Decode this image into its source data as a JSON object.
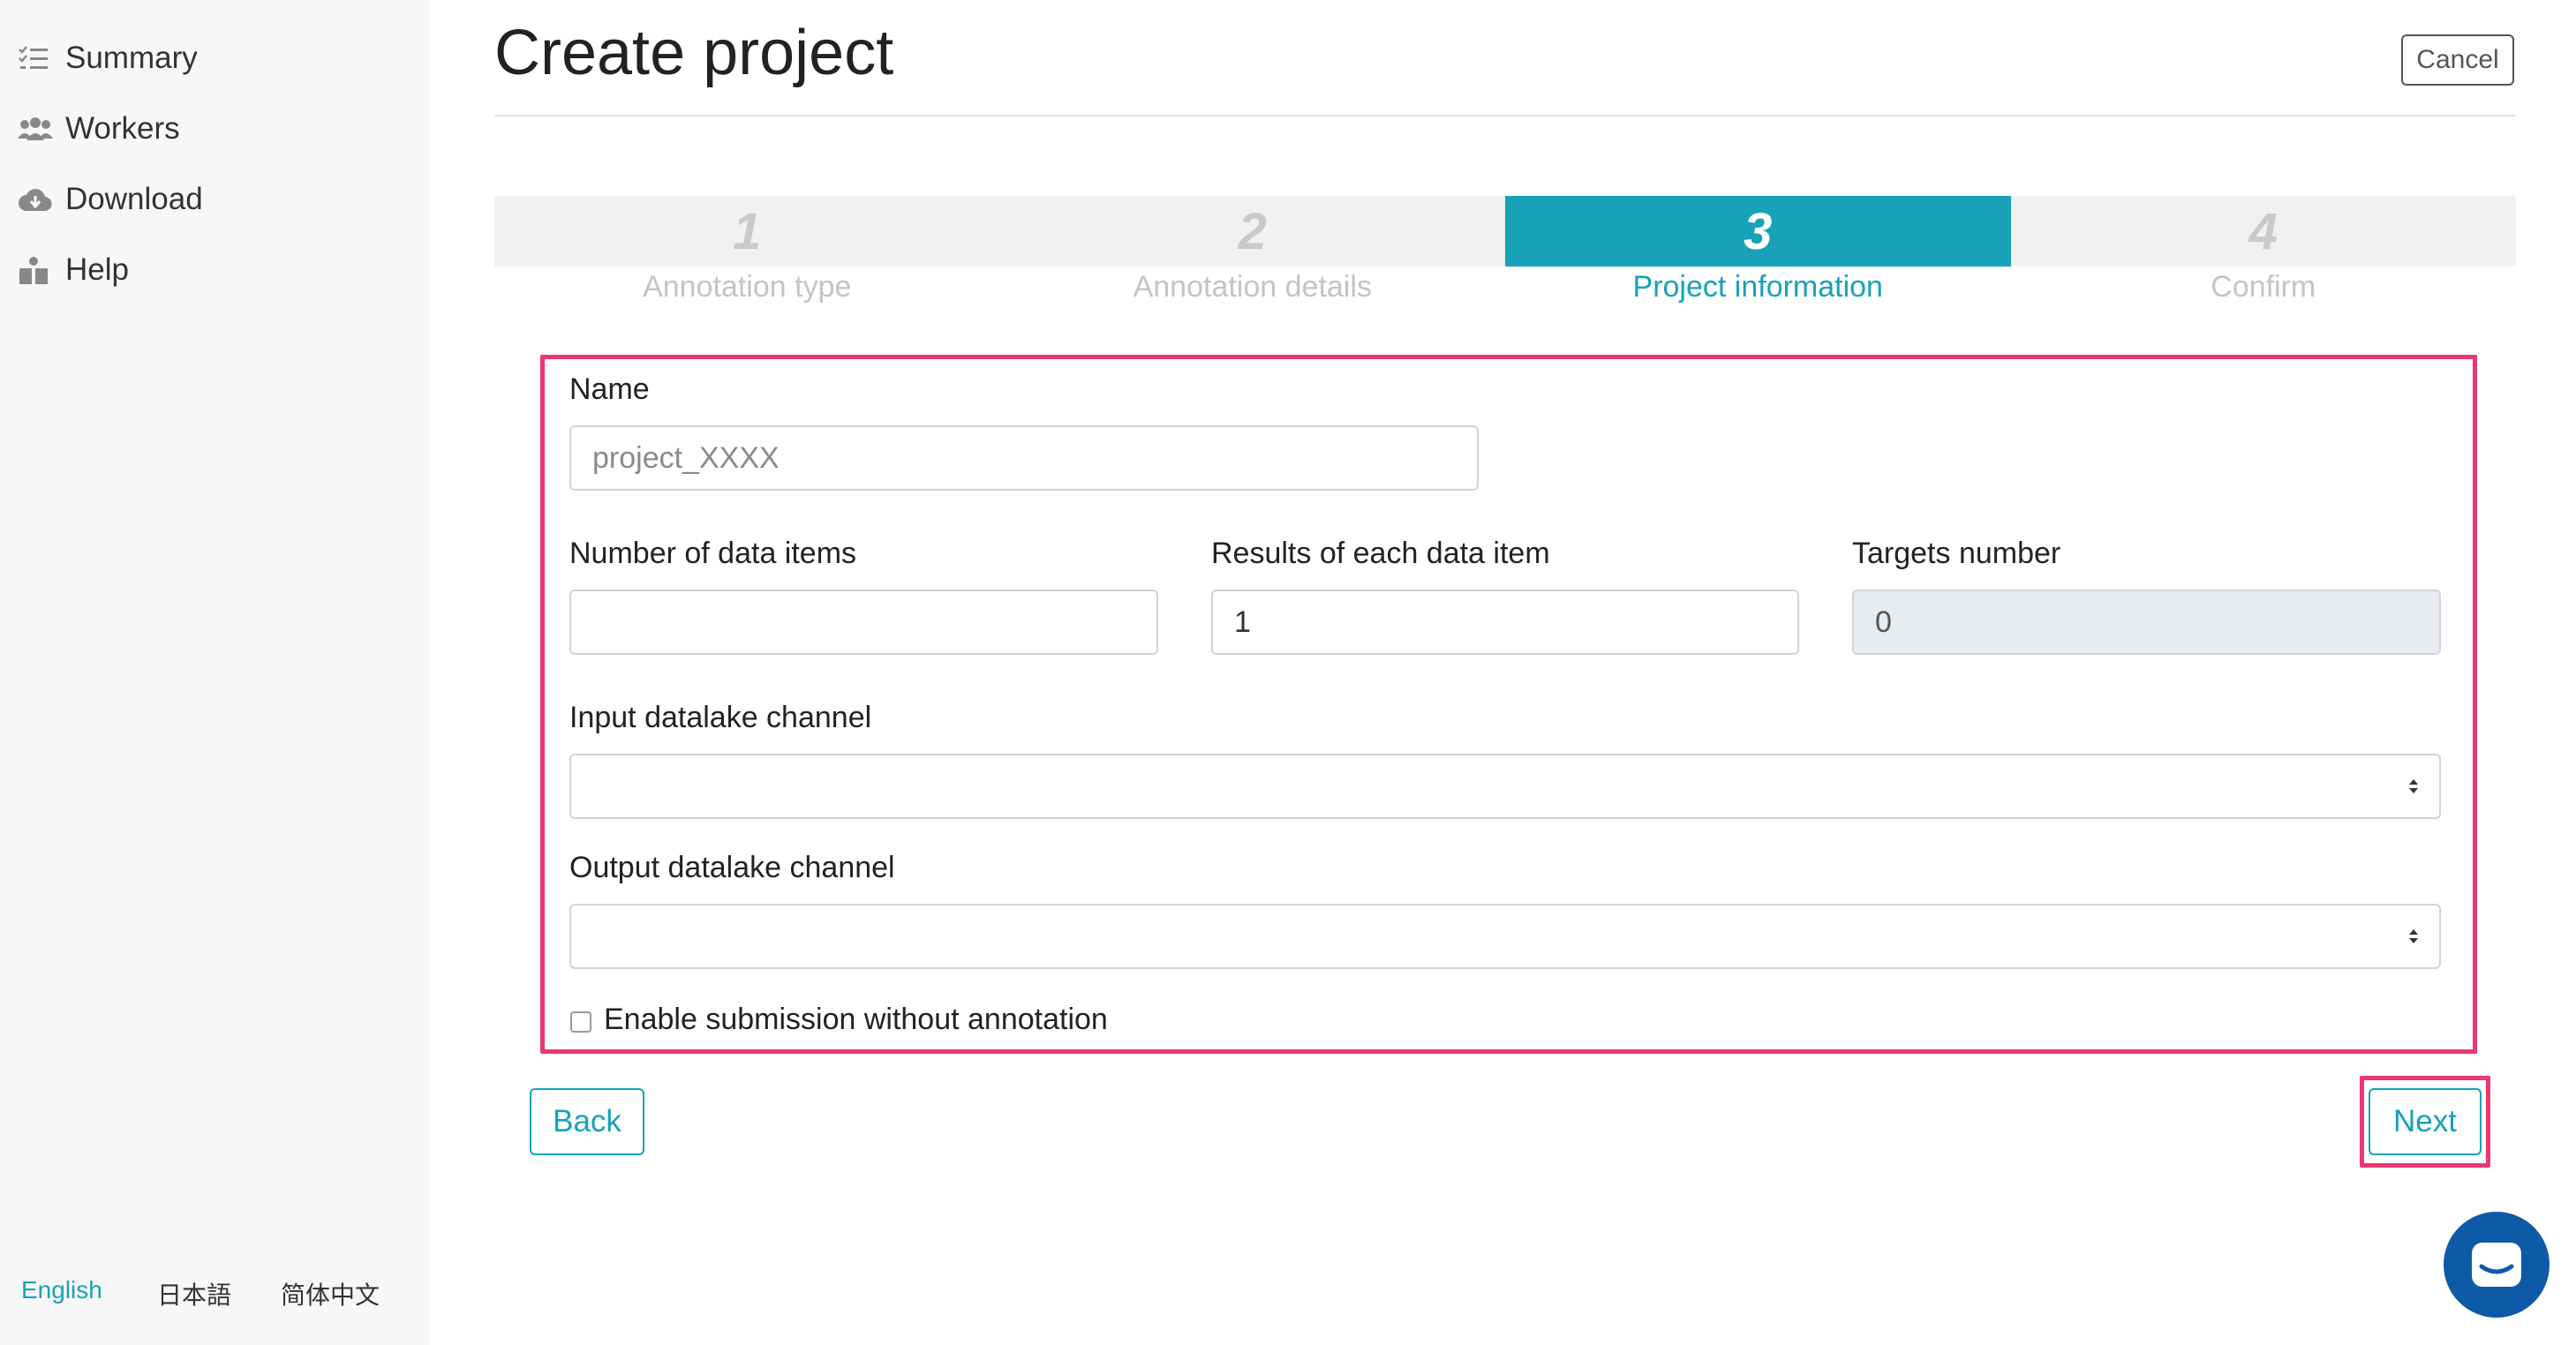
{
  "sidebar": {
    "items": [
      {
        "label": "Summary",
        "icon": "list-check-icon"
      },
      {
        "label": "Workers",
        "icon": "users-icon"
      },
      {
        "label": "Download",
        "icon": "cloud-download-icon"
      },
      {
        "label": "Help",
        "icon": "help-person-icon"
      }
    ],
    "languages": [
      {
        "label": "English",
        "active": true
      },
      {
        "label": "日本語",
        "active": false
      },
      {
        "label": "简体中文",
        "active": false
      }
    ]
  },
  "header": {
    "title": "Create project",
    "cancel_label": "Cancel"
  },
  "stepper": {
    "steps": [
      {
        "number": "1",
        "caption": "Annotation type",
        "active": false
      },
      {
        "number": "2",
        "caption": "Annotation details",
        "active": false
      },
      {
        "number": "3",
        "caption": "Project information",
        "active": true
      },
      {
        "number": "4",
        "caption": "Confirm",
        "active": false
      }
    ]
  },
  "form": {
    "name": {
      "label": "Name",
      "placeholder": "project_XXXX",
      "value": ""
    },
    "data_items": {
      "label": "Number of data items",
      "value": ""
    },
    "results_each": {
      "label": "Results of each data item",
      "value": "1"
    },
    "targets": {
      "label": "Targets number",
      "value": "0"
    },
    "input_channel": {
      "label": "Input datalake channel",
      "value": ""
    },
    "output_channel": {
      "label": "Output datalake channel",
      "value": ""
    },
    "enable_submission": {
      "label": "Enable submission without annotation",
      "checked": false
    }
  },
  "actions": {
    "back_label": "Back",
    "next_label": "Next"
  },
  "colors": {
    "accent": "#17a2b8",
    "highlight": "#ec3770",
    "chat": "#0d5aa7"
  }
}
